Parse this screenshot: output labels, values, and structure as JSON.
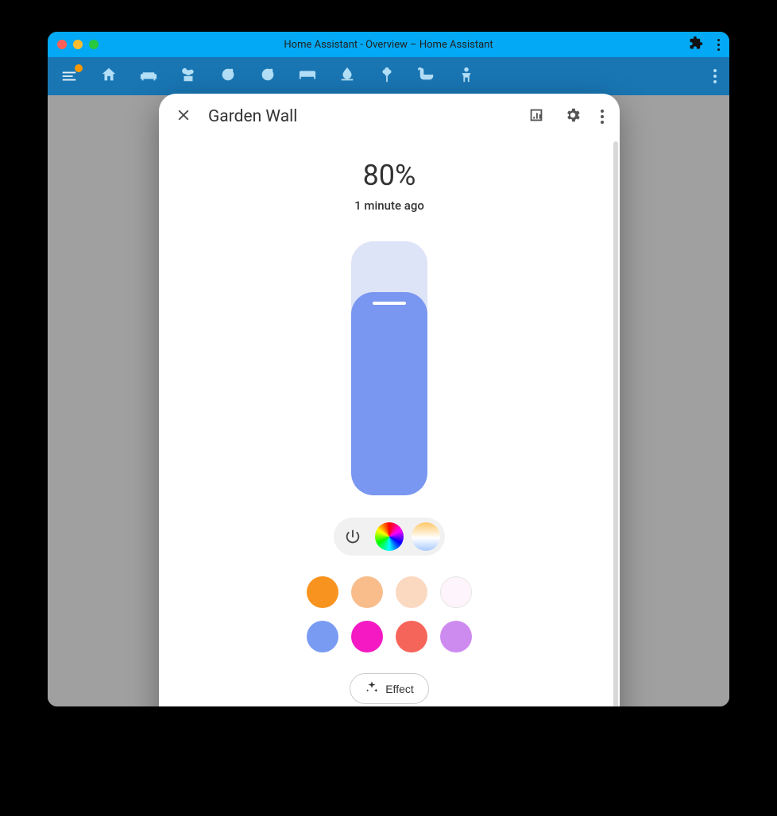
{
  "window": {
    "title": "Home Assistant - Overview – Home Assistant"
  },
  "toolbar": {
    "room_icons": [
      "home",
      "sofa",
      "teddy",
      "baby1",
      "baby2",
      "bed",
      "humidity",
      "flower",
      "bathtub",
      "person"
    ]
  },
  "dialog": {
    "title": "Garden Wall",
    "brightness_pct": "80%",
    "brightness_value": 80,
    "last_changed": "1 minute ago",
    "slider_color": "#7996f0",
    "effect_label": "Effect",
    "color_swatches": [
      {
        "name": "orange",
        "hex": "#f7931e",
        "bordered": false
      },
      {
        "name": "peach",
        "hex": "#f8bd8b",
        "bordered": false
      },
      {
        "name": "light-peach",
        "hex": "#fbd8c0",
        "bordered": false
      },
      {
        "name": "near-white",
        "hex": "#fdf5fb",
        "bordered": true
      },
      {
        "name": "periwinkle",
        "hex": "#7a9bf2",
        "bordered": false
      },
      {
        "name": "magenta",
        "hex": "#f419c3",
        "bordered": false
      },
      {
        "name": "coral",
        "hex": "#f6655a",
        "bordered": false
      },
      {
        "name": "lavender",
        "hex": "#cd8bef",
        "bordered": false
      }
    ]
  }
}
